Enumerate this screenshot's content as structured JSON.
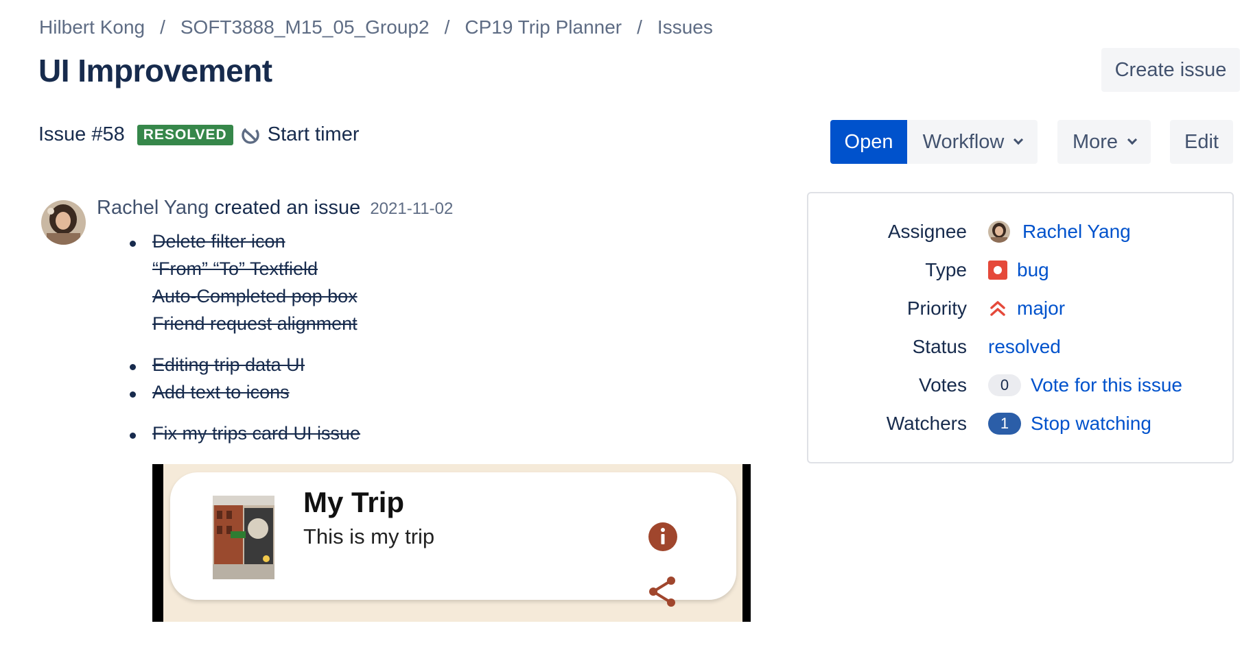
{
  "breadcrumb": {
    "items": [
      "Hilbert Kong",
      "SOFT3888_M15_05_Group2",
      "CP19 Trip Planner",
      "Issues"
    ],
    "separator": "/"
  },
  "header": {
    "title": "UI Improvement",
    "create_issue_label": "Create issue"
  },
  "toolbar": {
    "open_label": "Open",
    "workflow_label": "Workflow",
    "more_label": "More",
    "edit_label": "Edit"
  },
  "issue": {
    "number_label": "Issue #58",
    "status_badge": "RESOLVED",
    "start_timer_label": "Start timer",
    "author": "Rachel Yang",
    "action_text": "created an issue",
    "created_date": "2021-11-02",
    "description_items": [
      "Delete filter icon",
      "“From” “To” Textfield",
      "Auto-Completed pop box",
      "Friend request alignment",
      "Editing trip data UI",
      "Add text to icons",
      "Fix my trips card UI issue"
    ],
    "screenshot": {
      "title": "My Trip",
      "subtitle": "This is my trip"
    }
  },
  "sidebar": {
    "assignee": {
      "label": "Assignee",
      "value": "Rachel Yang"
    },
    "type": {
      "label": "Type",
      "value": "bug"
    },
    "priority": {
      "label": "Priority",
      "value": "major"
    },
    "status": {
      "label": "Status",
      "value": "resolved"
    },
    "votes": {
      "label": "Votes",
      "count": "0",
      "action": "Vote for this issue"
    },
    "watchers": {
      "label": "Watchers",
      "count": "1",
      "action": "Stop watching"
    }
  },
  "colors": {
    "primary": "#0052cc",
    "resolved_badge": "#36874a",
    "bug": "#e5493a",
    "priority_major": "#e5493a",
    "watchers_badge": "#2b5ea8"
  }
}
